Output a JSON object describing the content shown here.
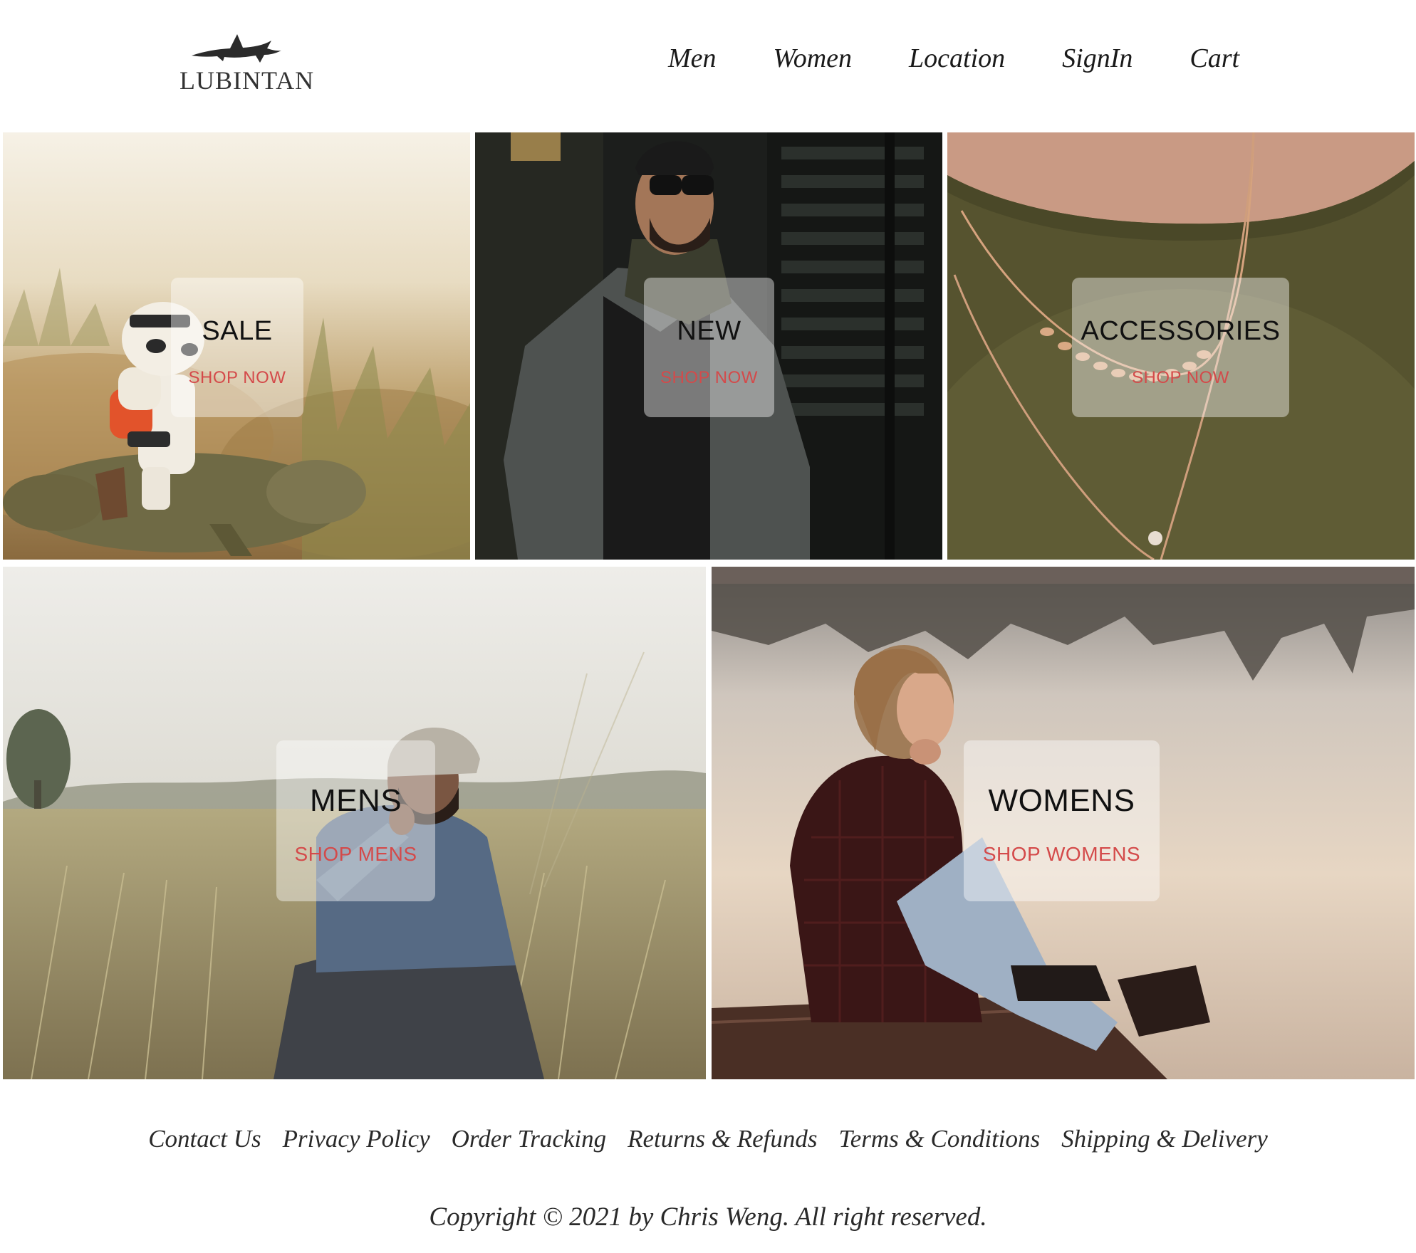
{
  "brand": {
    "name": "LUBINTAN",
    "logo_icon": "shark-icon"
  },
  "nav": {
    "items": [
      "Men",
      "Women",
      "Location",
      "SignIn",
      "Cart"
    ]
  },
  "tiles": {
    "sale": {
      "title": "SALE",
      "cta": "SHOP NOW",
      "image": "stormtrooper-toy-riding-lizard-in-grass"
    },
    "new": {
      "title": "NEW",
      "cta": "SHOP NOW",
      "image": "man-in-grey-coat-and-sunglasses"
    },
    "accessories": {
      "title": "ACCESSORIES",
      "cta": "SHOP NOW",
      "image": "gold-necklaces-on-olive-top"
    },
    "mens": {
      "title": "MENS",
      "cta": "SHOP MENS",
      "image": "man-in-beanie-sitting-in-tall-grass"
    },
    "womens": {
      "title": "WOMENS",
      "cta": "SHOP WOMENS",
      "image": "woman-sitting-on-dock-by-lake"
    }
  },
  "footer": {
    "links": [
      "Contact Us",
      "Privacy Policy",
      "Order Tracking",
      "Returns & Refunds",
      "Terms & Conditions",
      "Shipping & Delivery"
    ],
    "copyright": "Copyright © 2021 by Chris Weng. All right reserved."
  },
  "colors": {
    "cta": "#d44a4a",
    "text": "#1a1a1a",
    "card_overlay": "rgba(255,255,255,0.42)"
  }
}
